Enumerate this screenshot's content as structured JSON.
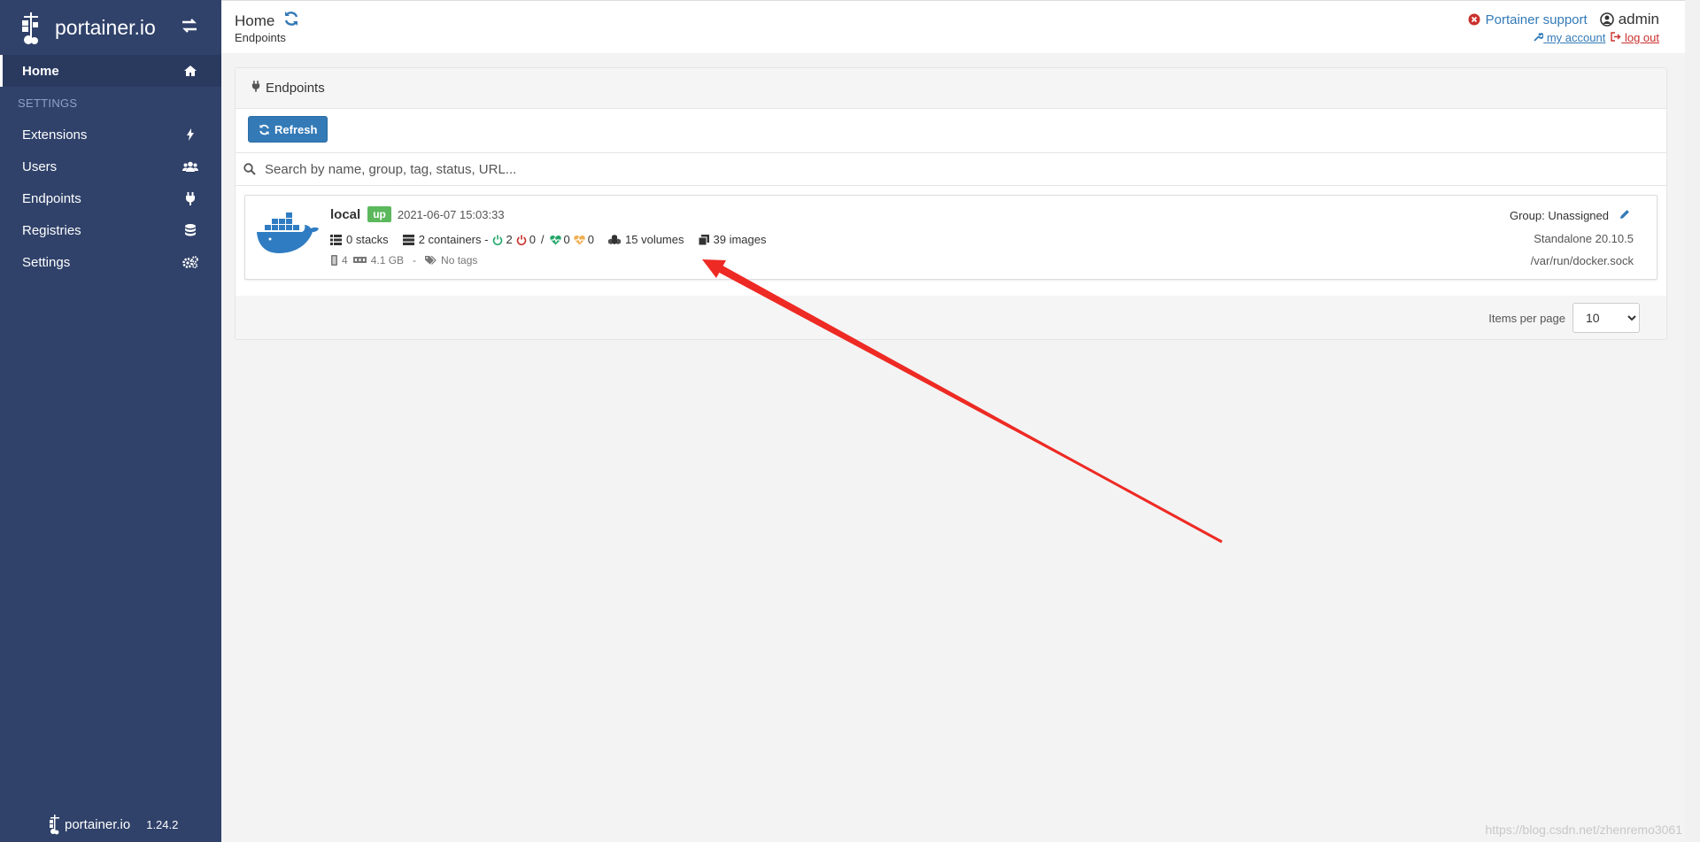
{
  "sidebar": {
    "brand": "portainer.io",
    "home_label": "Home",
    "section_label": "SETTINGS",
    "items": [
      {
        "label": "Extensions",
        "icon": "bolt-icon"
      },
      {
        "label": "Users",
        "icon": "users-icon"
      },
      {
        "label": "Endpoints",
        "icon": "plug-icon"
      },
      {
        "label": "Registries",
        "icon": "database-icon"
      },
      {
        "label": "Settings",
        "icon": "cogs-icon"
      }
    ],
    "footer_brand": "portainer.io",
    "version": "1.24.2"
  },
  "header": {
    "title": "Home",
    "breadcrumb": "Endpoints",
    "support_label": "Portainer support",
    "user": "admin",
    "my_account_label": "my account",
    "logout_label": "log out"
  },
  "widget": {
    "title": "Endpoints",
    "refresh_label": "Refresh",
    "search_placeholder": "Search by name, group, tag, status, URL...",
    "items_per_page_label": "Items per page",
    "items_per_page_value": "10"
  },
  "endpoint": {
    "name": "local",
    "status": "up",
    "date": "2021-06-07 15:03:33",
    "stacks": "0 stacks",
    "containers": "2 containers -",
    "running": "2",
    "stopped": "0",
    "separator": "/",
    "healthy": "0",
    "unhealthy": "0",
    "volumes": "15 volumes",
    "images": "39 images",
    "cpu": "4",
    "memory": "4.1 GB",
    "dash": "-",
    "tags": "No tags",
    "group": "Group: Unassigned",
    "version": "Standalone 20.10.5",
    "url": "/var/run/docker.sock"
  },
  "colors": {
    "sidebar_bg": "#30426a",
    "accent": "#337ab7",
    "status_up": "#5cb85c",
    "annotation_arrow": "#ee2a24"
  },
  "watermark": "https://blog.csdn.net/zhenremo3061"
}
